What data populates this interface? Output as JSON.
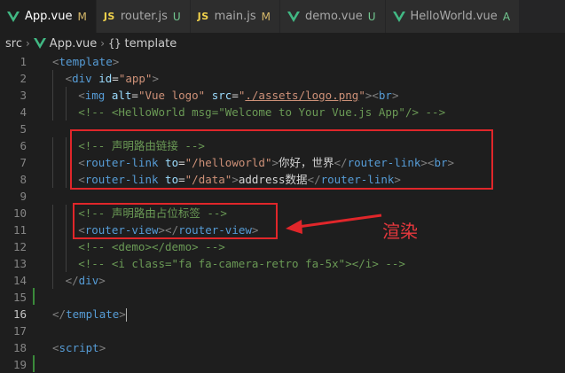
{
  "tabs": [
    {
      "icon": "vue-icon",
      "label": "App.vue",
      "status": "M",
      "status_class": "st-M",
      "active": true
    },
    {
      "icon": "js-icon",
      "icon_text": "JS",
      "label": "router.js",
      "status": "U",
      "status_class": "st-U",
      "active": false
    },
    {
      "icon": "js-icon",
      "icon_text": "JS",
      "label": "main.js",
      "status": "M",
      "status_class": "st-M",
      "active": false
    },
    {
      "icon": "vue-icon",
      "label": "demo.vue",
      "status": "U",
      "status_class": "st-U",
      "active": false
    },
    {
      "icon": "vue-icon",
      "label": "HelloWorld.vue",
      "status": "A",
      "status_class": "st-A",
      "active": false
    }
  ],
  "breadcrumb": {
    "folder": "src",
    "file": "App.vue",
    "symbol": "template",
    "symbol_icon": "{}"
  },
  "code_lines": [
    {
      "n": "1",
      "indent": 0,
      "tokens": [
        [
          "tg",
          "<"
        ],
        [
          "tn",
          "template"
        ],
        [
          "tg",
          ">"
        ]
      ]
    },
    {
      "n": "2",
      "indent": 1,
      "tokens": [
        [
          "tg",
          "<"
        ],
        [
          "tn",
          "div"
        ],
        [
          "tx",
          " "
        ],
        [
          "an",
          "id"
        ],
        [
          "tx",
          "="
        ],
        [
          "av",
          "\"app\""
        ],
        [
          "tg",
          ">"
        ]
      ]
    },
    {
      "n": "3",
      "indent": 2,
      "tokens": [
        [
          "tg",
          "<"
        ],
        [
          "tn",
          "img"
        ],
        [
          "tx",
          " "
        ],
        [
          "an",
          "alt"
        ],
        [
          "tx",
          "="
        ],
        [
          "av",
          "\"Vue logo\""
        ],
        [
          "tx",
          " "
        ],
        [
          "an",
          "src"
        ],
        [
          "tx",
          "="
        ],
        [
          "av",
          "\""
        ],
        [
          "av ul",
          "./assets/logo.png"
        ],
        [
          "av",
          "\""
        ],
        [
          "tg",
          ">"
        ],
        [
          "tg",
          "<"
        ],
        [
          "tn",
          "br"
        ],
        [
          "tg",
          ">"
        ]
      ]
    },
    {
      "n": "4",
      "indent": 2,
      "tokens": [
        [
          "cm",
          "<!-- <HelloWorld msg=\"Welcome to Your Vue.js App\"/> -->"
        ]
      ]
    },
    {
      "n": "5",
      "indent": 0,
      "tokens": []
    },
    {
      "n": "6",
      "indent": 2,
      "tokens": [
        [
          "cm",
          "<!-- 声明路由链接 -->"
        ]
      ]
    },
    {
      "n": "7",
      "indent": 2,
      "tokens": [
        [
          "tg",
          "<"
        ],
        [
          "tn",
          "router-link"
        ],
        [
          "tx",
          " "
        ],
        [
          "an",
          "to"
        ],
        [
          "tx",
          "="
        ],
        [
          "av",
          "\"/helloworld\""
        ],
        [
          "tg",
          ">"
        ],
        [
          "tx",
          "你好，世界"
        ],
        [
          "tg",
          "</"
        ],
        [
          "tn",
          "router-link"
        ],
        [
          "tg",
          ">"
        ],
        [
          "tg",
          "<"
        ],
        [
          "tn",
          "br"
        ],
        [
          "tg",
          ">"
        ]
      ]
    },
    {
      "n": "8",
      "indent": 2,
      "tokens": [
        [
          "tg",
          "<"
        ],
        [
          "tn",
          "router-link"
        ],
        [
          "tx",
          " "
        ],
        [
          "an",
          "to"
        ],
        [
          "tx",
          "="
        ],
        [
          "av",
          "\"/data\""
        ],
        [
          "tg",
          ">"
        ],
        [
          "tx",
          "address数据"
        ],
        [
          "tg",
          "</"
        ],
        [
          "tn",
          "router-link"
        ],
        [
          "tg",
          ">"
        ]
      ]
    },
    {
      "n": "9",
      "indent": 0,
      "tokens": []
    },
    {
      "n": "10",
      "indent": 2,
      "tokens": [
        [
          "cm",
          "<!-- 声明路由占位标签 -->"
        ]
      ]
    },
    {
      "n": "11",
      "indent": 2,
      "tokens": [
        [
          "tg",
          "<"
        ],
        [
          "tn",
          "router-view"
        ],
        [
          "tg",
          ">"
        ],
        [
          "tg",
          "</"
        ],
        [
          "tn",
          "router-view"
        ],
        [
          "tg",
          ">"
        ]
      ]
    },
    {
      "n": "12",
      "indent": 2,
      "tokens": [
        [
          "cm",
          "<!-- <demo></demo> -->"
        ]
      ]
    },
    {
      "n": "13",
      "indent": 2,
      "tokens": [
        [
          "cm",
          "<!-- <i class=\"fa fa-camera-retro fa-5x\"></i> -->"
        ]
      ]
    },
    {
      "n": "14",
      "indent": 1,
      "tokens": [
        [
          "tg",
          "</"
        ],
        [
          "tn",
          "div"
        ],
        [
          "tg",
          ">"
        ]
      ]
    },
    {
      "n": "15",
      "indent": 0,
      "tokens": []
    },
    {
      "n": "16",
      "indent": 0,
      "cursor": true,
      "tokens": [
        [
          "tg",
          "</"
        ],
        [
          "tn",
          "template"
        ],
        [
          "tg",
          ">"
        ]
      ]
    },
    {
      "n": "17",
      "indent": 0,
      "tokens": []
    },
    {
      "n": "18",
      "indent": 0,
      "tokens": [
        [
          "tg",
          "<"
        ],
        [
          "tn",
          "script"
        ],
        [
          "tg",
          ">"
        ]
      ]
    },
    {
      "n": "19",
      "indent": 0,
      "tokens": []
    }
  ],
  "annotation": {
    "label": "渲染",
    "color": "#e0262a"
  }
}
